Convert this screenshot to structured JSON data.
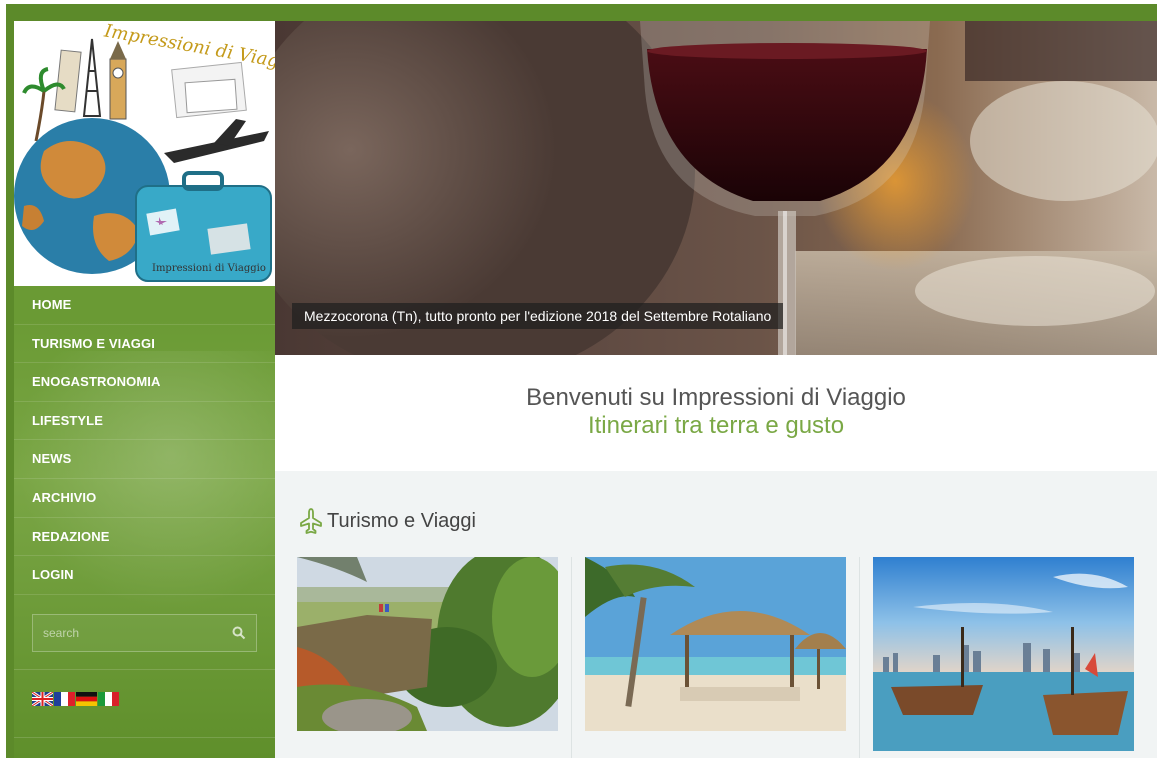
{
  "site": {
    "name": "Impressioni di Viaggio",
    "logo_script_text": "Impressioni di Viaggio"
  },
  "nav": {
    "items": [
      {
        "label": "HOME"
      },
      {
        "label": "TURISMO E VIAGGI"
      },
      {
        "label": "ENOGASTRONOMIA"
      },
      {
        "label": "LIFESTYLE"
      },
      {
        "label": "NEWS"
      },
      {
        "label": "ARCHIVIO"
      },
      {
        "label": "REDAZIONE"
      },
      {
        "label": "LOGIN"
      }
    ]
  },
  "search": {
    "placeholder": "search",
    "icon": "search-icon"
  },
  "languages": [
    {
      "code": "en",
      "icon": "flag-uk-icon"
    },
    {
      "code": "fr",
      "icon": "flag-france-icon"
    },
    {
      "code": "de",
      "icon": "flag-germany-icon"
    },
    {
      "code": "it",
      "icon": "flag-italy-icon"
    }
  ],
  "hero": {
    "caption": "Mezzocorona (Tn), tutto pronto per l'edizione 2018 del Settembre Rotaliano"
  },
  "welcome": {
    "title": "Benvenuti su Impressioni di Viaggio",
    "subtitle": "Itinerari tra terra e gusto"
  },
  "section": {
    "title": "Turismo e Viaggi",
    "icon": "airplane-icon"
  },
  "colors": {
    "brand_green": "#5c8a2a",
    "accent_green": "#7aa845",
    "section_bg": "#f1f4f4"
  }
}
